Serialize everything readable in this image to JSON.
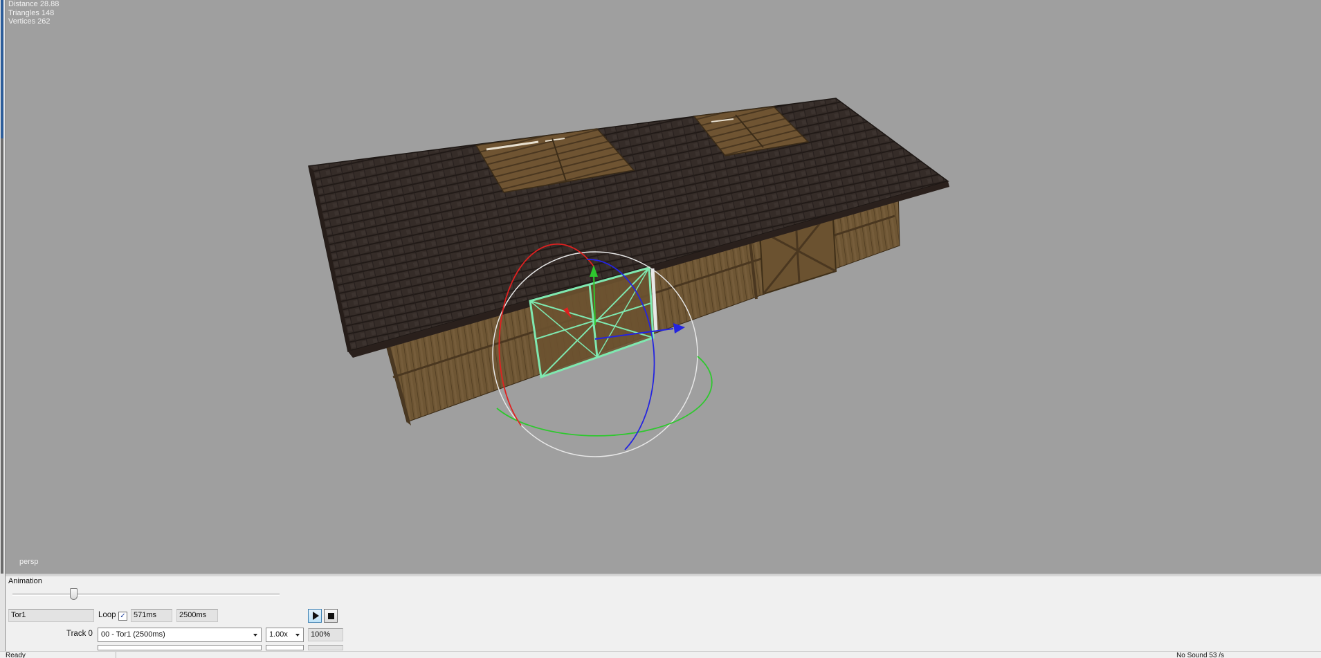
{
  "viewport": {
    "stats": {
      "distance": "Distance 28.88",
      "triangles": "Triangles 148",
      "vertices": "Vertices 262"
    },
    "camera_label": "persp",
    "background_color": "#9f9f9f"
  },
  "animation_panel": {
    "title": "Animation",
    "slider_position": 0.228,
    "animation_name": "Tor1",
    "loop_label": "Loop",
    "loop_checked": true,
    "loop_check_glyph": "✓",
    "current_time": "571ms",
    "total_time": "2500ms",
    "play_button_icon": "play-icon",
    "stop_button_icon": "stop-icon",
    "track_label": "Track 0",
    "track_select": "00 - Tor1 (2500ms)",
    "speed_select": "1.00x",
    "weight": "100%"
  },
  "statusbar": {
    "left_text": "Ready",
    "right_text": "No Sound 53 /s"
  }
}
